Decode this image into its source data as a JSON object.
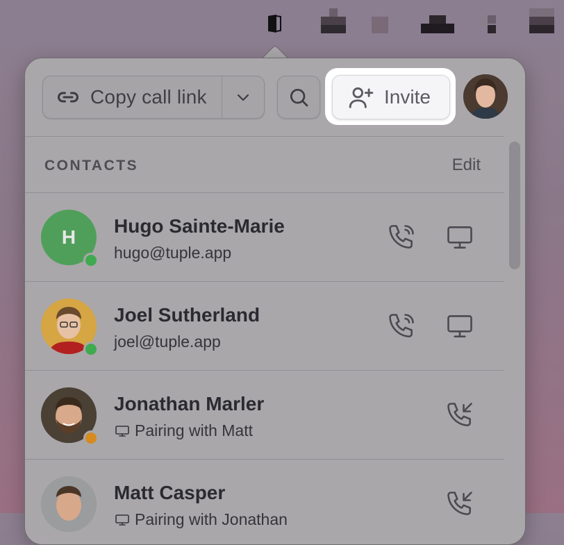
{
  "toolbar": {
    "copy_link_label": "Copy call link",
    "invite_label": "Invite"
  },
  "contacts": {
    "title": "CONTACTS",
    "edit_label": "Edit",
    "items": [
      {
        "name": "Hugo Sainte-Marie",
        "subtitle": "hugo@tuple.app",
        "initial": "H",
        "status": "online",
        "status_color": "#3faa4f",
        "avatar_color": "#4f9f5a"
      },
      {
        "name": "Joel Sutherland",
        "subtitle": "joel@tuple.app",
        "status": "online",
        "status_color": "#3faa4f"
      },
      {
        "name": "Jonathan Marler",
        "subtitle": "Pairing with Matt",
        "status": "busy",
        "status_color": "#d68b1e"
      },
      {
        "name": "Matt Casper",
        "subtitle": "Pairing with Jonathan",
        "status": "busy",
        "status_color": "#d68b1e"
      }
    ]
  },
  "icons": [
    "link-icon",
    "chevron-down-icon",
    "search-icon",
    "add-user-icon",
    "phone-call-icon",
    "monitor-icon",
    "incoming-call-icon"
  ]
}
